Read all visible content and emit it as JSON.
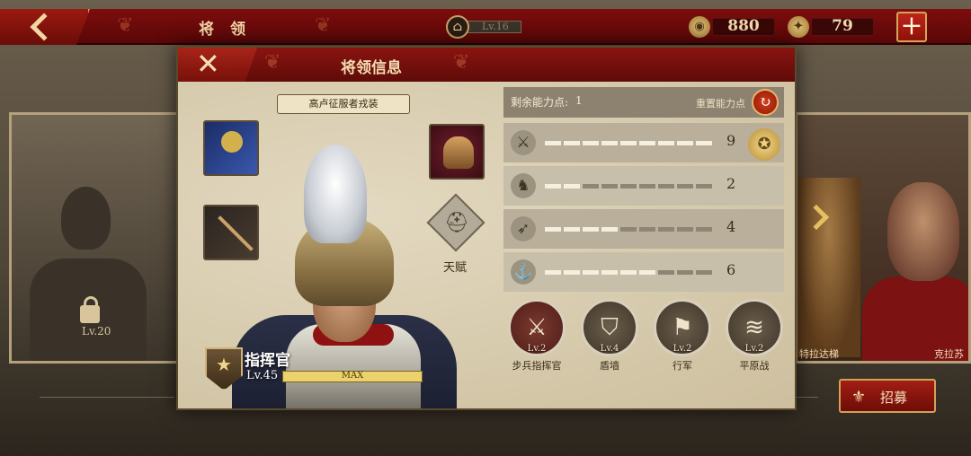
{
  "topbar": {
    "title": "将 领",
    "level": "Lv.16",
    "coins": "880",
    "tokens": "79",
    "add": "+"
  },
  "background": {
    "locked_level": "Lv.20",
    "right_names": [
      "特拉达梯",
      "克拉苏"
    ],
    "recruit": "招募"
  },
  "modal": {
    "title": "将领信息",
    "close": "✕",
    "outfit": "高卢征服者戎装",
    "talent_label": "天赋",
    "general": {
      "rank": "指挥官",
      "level": "Lv.45",
      "xp_label": "MAX",
      "xp_fraction": 1.0
    },
    "points": {
      "label": "剩余能力点:",
      "value": "1",
      "reset_label": "重置能力点"
    },
    "stats": [
      {
        "icon": "sword-icon",
        "glyph": "⚔",
        "value": "9",
        "filled": 9
      },
      {
        "icon": "horse-icon",
        "glyph": "♞",
        "value": "2",
        "filled": 2
      },
      {
        "icon": "bow-icon",
        "glyph": "➶",
        "value": "4",
        "filled": 4
      },
      {
        "icon": "anchor-icon",
        "glyph": "⚓",
        "value": "6",
        "filled": 6
      }
    ],
    "stat_segments": 9,
    "skills": [
      {
        "name": "步兵指挥官",
        "level": "Lv.2",
        "glyph": "⚔",
        "icon": "crossed-swords-icon"
      },
      {
        "name": "盾墙",
        "level": "Lv.4",
        "glyph": "⛉",
        "icon": "shield-wall-icon"
      },
      {
        "name": "行军",
        "level": "Lv.2",
        "glyph": "⚑",
        "icon": "march-icon"
      },
      {
        "name": "平原战",
        "level": "Lv.2",
        "glyph": "≋",
        "icon": "plains-icon"
      }
    ]
  }
}
